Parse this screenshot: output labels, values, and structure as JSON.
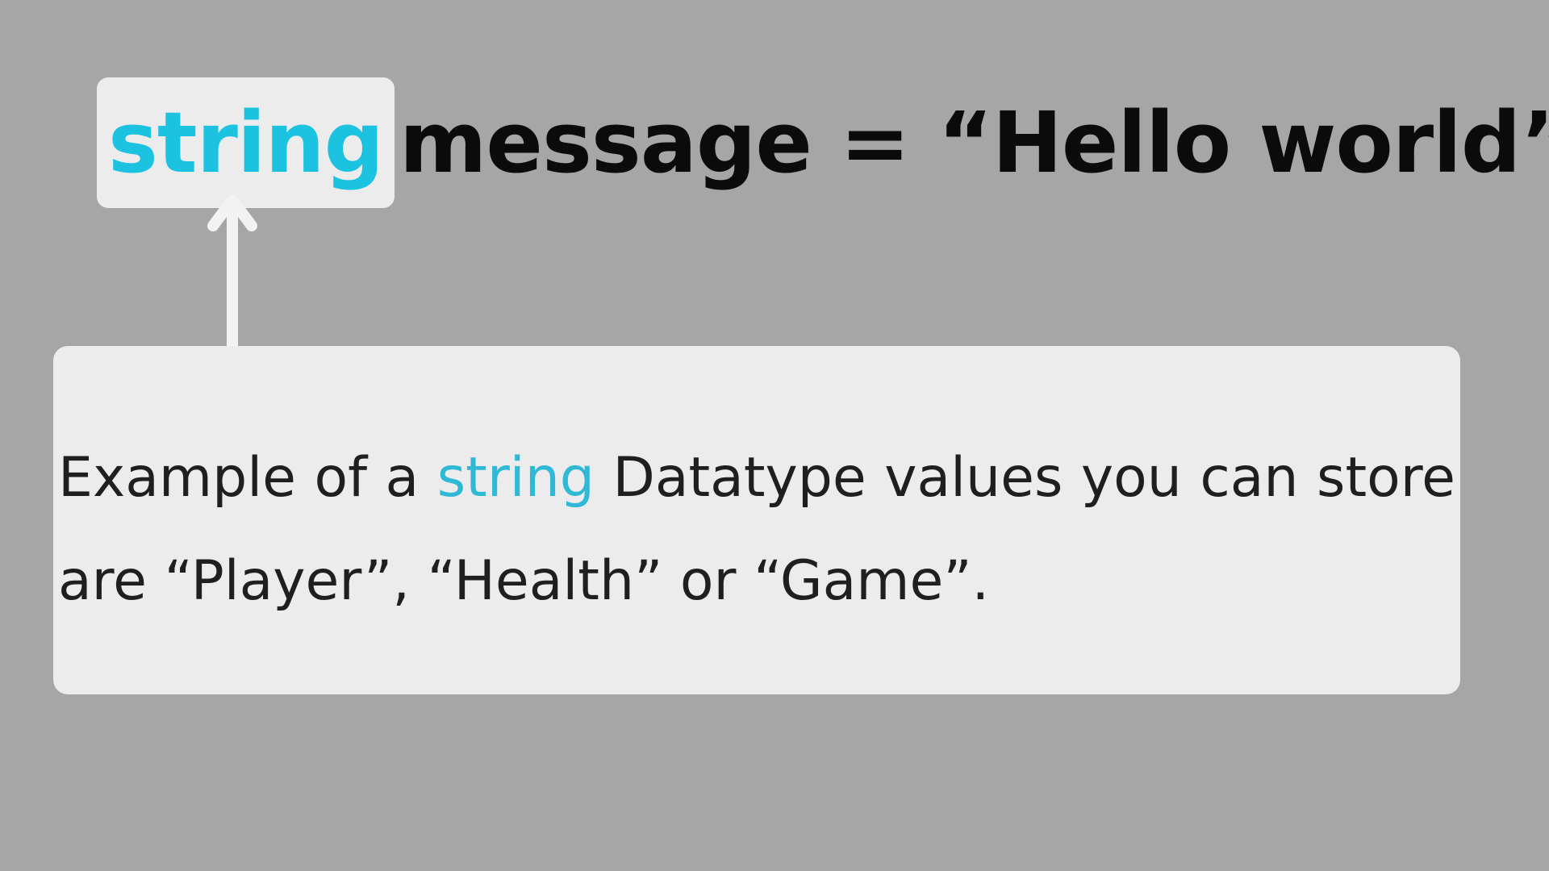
{
  "code": {
    "keyword": "string",
    "rest": "message = “Hello world”"
  },
  "note": {
    "before": "Example of a",
    "highlight": "string",
    "after": "Datatype values you can store are “Player”, “Health” or “Game”."
  },
  "colors": {
    "background": "#a6a6a6",
    "box": "#ececec",
    "keyword": "#1cc3e1",
    "highlight": "#2fb9d6",
    "text": "#0b0b0b",
    "arrow": "#f2f2f2"
  },
  "icons": {
    "pointer": "arrow-up-icon"
  }
}
